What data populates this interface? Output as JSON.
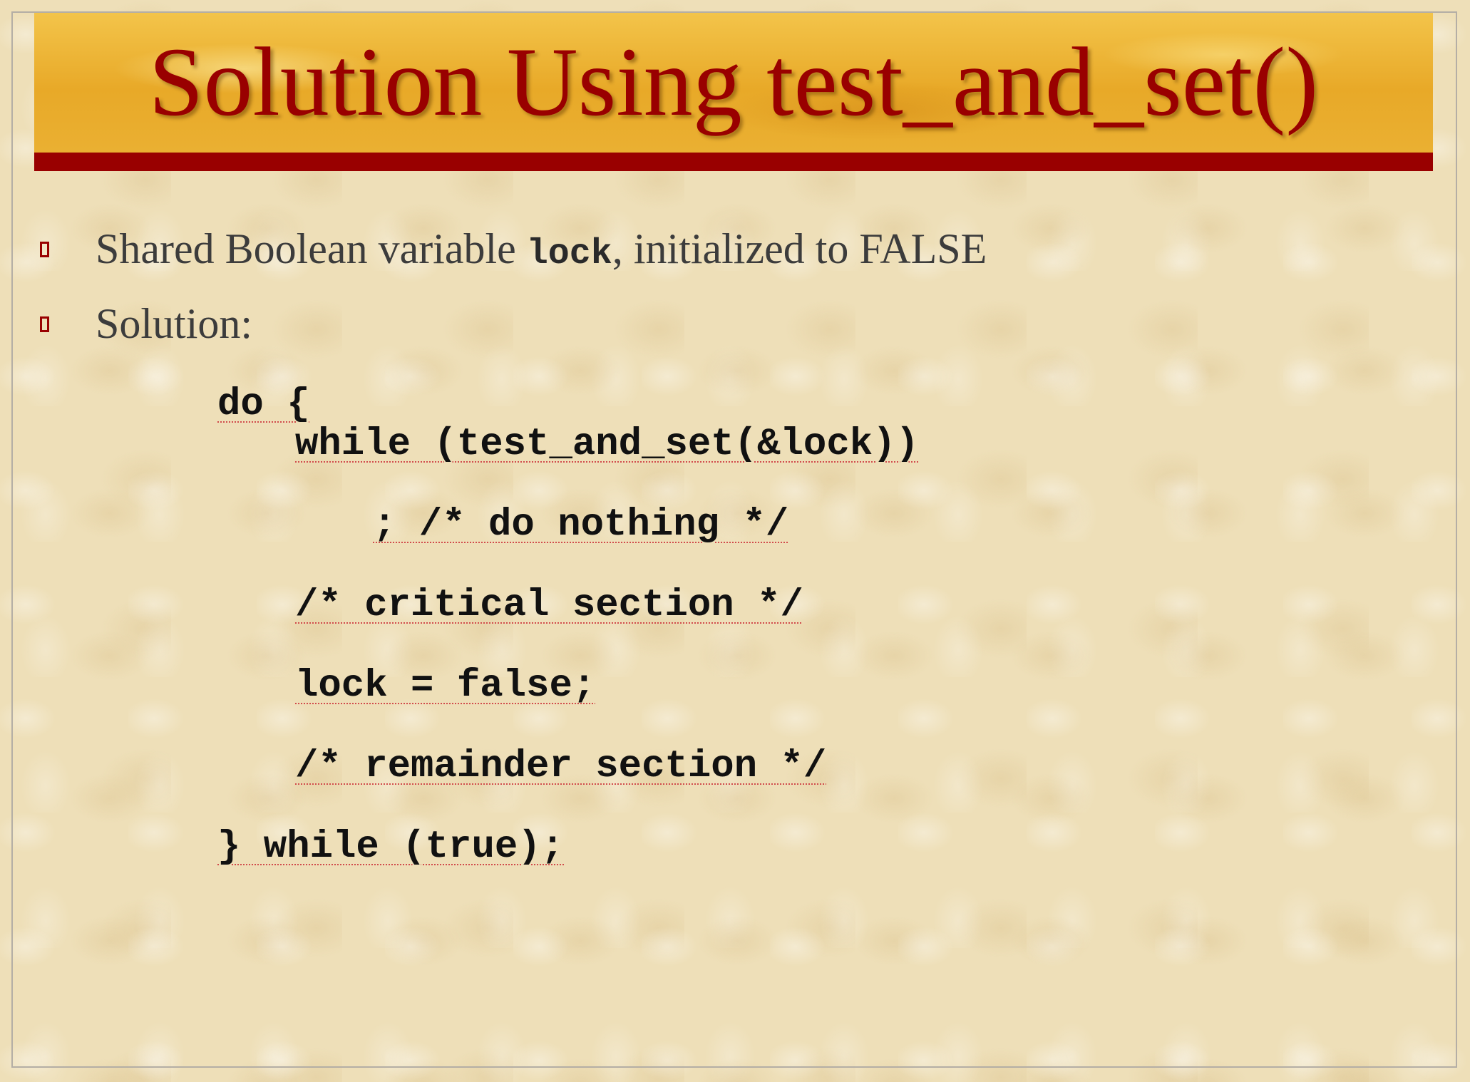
{
  "slide": {
    "title": "Solution Using test_and_set()"
  },
  "bullets": [
    {
      "text_before": "Shared Boolean variable ",
      "code": "lock",
      "text_after": ", initialized to FALSE"
    },
    {
      "text": "Solution:"
    }
  ],
  "code_lines": [
    "do {",
    "while (test_and_set(&lock))",
    "; /* do nothing */",
    "/* critical section */",
    "lock = false;",
    "/* remainder section */",
    "} while (true);"
  ],
  "colors": {
    "accent": "#990000",
    "banner": "#e8a928",
    "background": "#eedfb8"
  }
}
